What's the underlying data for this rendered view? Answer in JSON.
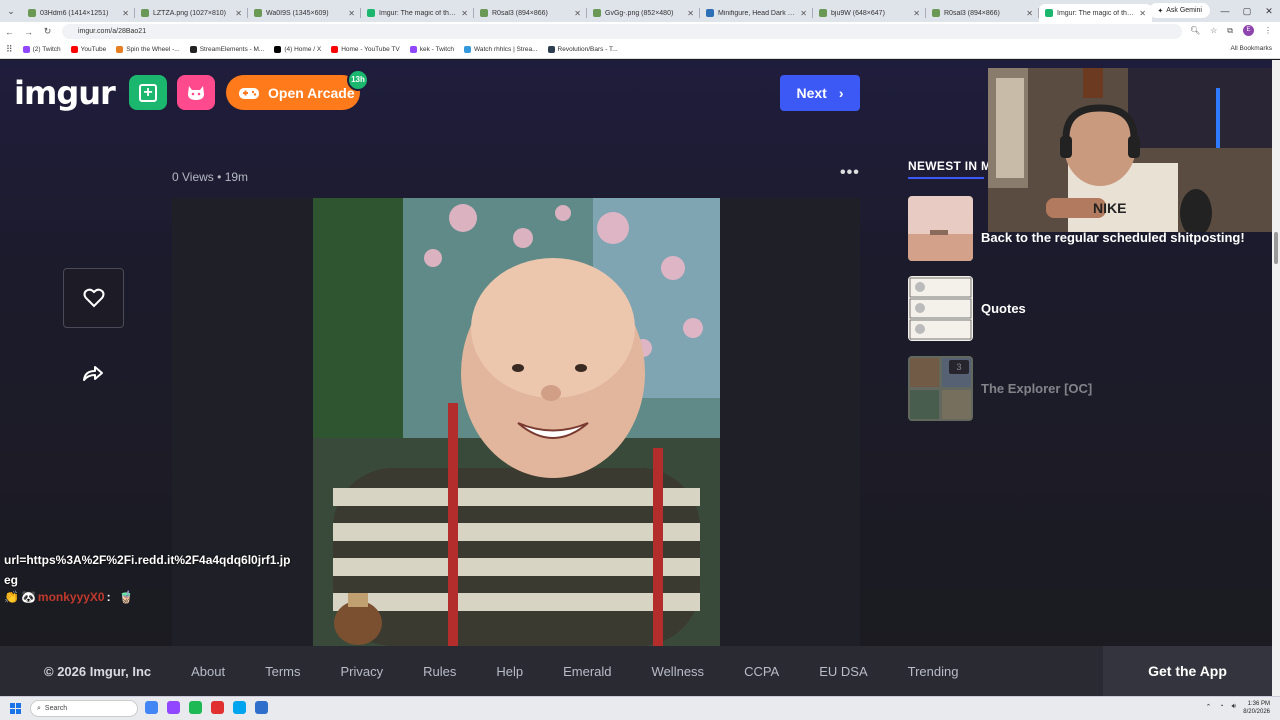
{
  "browser": {
    "tabs": [
      {
        "label": "03Hdm6 (1414×1251)",
        "color": "#6a9955",
        "active": false
      },
      {
        "label": "LZTZA.png (1027×810)",
        "color": "#6a9955",
        "active": false
      },
      {
        "label": "Wa0I9S (1345×609)",
        "color": "#6a9955",
        "active": false
      },
      {
        "label": "Imgur: The magic of the Int",
        "color": "#1bb76e",
        "active": false
      },
      {
        "label": "R0sal3 (894×866)",
        "color": "#6a9955",
        "active": false
      },
      {
        "label": "GvGg-.png (852×480)",
        "color": "#6a9955",
        "active": false
      },
      {
        "label": "Minifigure, Head Dark Brow",
        "color": "#2c6fb7",
        "active": false
      },
      {
        "label": "bju9W (648×647)",
        "color": "#6a9955",
        "active": false
      },
      {
        "label": "R0sal3 (894×866)",
        "color": "#6a9955",
        "active": false
      },
      {
        "label": "Imgur: The magic of the In",
        "color": "#1bb76e",
        "active": true
      }
    ],
    "new_tab_symbol": "+",
    "ask_gemini": "Ask Gemini",
    "url": "imgur.com/a/28Bao21",
    "profile_initial": "E",
    "bookmarks": [
      {
        "label": "(2) Twitch",
        "color": "#9146ff"
      },
      {
        "label": "YouTube",
        "color": "#ff0000"
      },
      {
        "label": "Spin the Wheel -...",
        "color": "#e67e22"
      },
      {
        "label": "StreamElements - M...",
        "color": "#222222"
      },
      {
        "label": "(4) Home / X",
        "color": "#000000"
      },
      {
        "label": "Home - YouTube TV",
        "color": "#ff0000"
      },
      {
        "label": "kek - Twitch",
        "color": "#9146ff"
      },
      {
        "label": "Watch rhhlcs | Strea...",
        "color": "#3498db"
      },
      {
        "label": "Revolution/Bars - T...",
        "color": "#2c3e50"
      }
    ],
    "all_bookmarks": "All Bookmarks"
  },
  "imgur": {
    "logo": "imgur",
    "arcade_label": "Open Arcade",
    "arcade_badge": "13h",
    "next_label": "Next",
    "views": "0 Views",
    "separator": "•",
    "time_ago": "19m",
    "more_symbol": "•••",
    "newest_title": "NEWEST IN M",
    "newest_items": [
      {
        "title": "Back to the regular scheduled shitposting!",
        "title_visible": "W...\nBack to the regular scheduled\nshitposting!"
      },
      {
        "title": "Quotes"
      },
      {
        "title": "The Explorer [OC]",
        "badge": "3"
      }
    ]
  },
  "chat": {
    "line1": "url=https%3A%2F%2Fi.redd.it%2F4a4qdq6l0jrf1.jp",
    "line2": "eg",
    "username": "monkyyyX0",
    "colon": ":"
  },
  "footer": {
    "copyright": "© 2026 Imgur, Inc",
    "links": [
      "About",
      "Terms",
      "Privacy",
      "Rules",
      "Help",
      "Emerald",
      "Wellness",
      "CCPA",
      "EU DSA",
      "Trending"
    ],
    "get_app": "Get the App"
  },
  "taskbar": {
    "search_placeholder": "Search",
    "time": "1:36 PM",
    "date": "8/20/2026"
  }
}
